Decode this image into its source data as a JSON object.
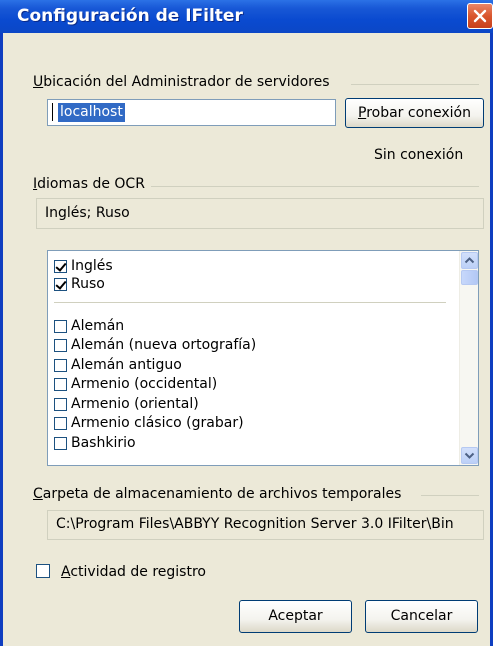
{
  "window": {
    "title": "Configuración de IFilter"
  },
  "server": {
    "label_key": "U",
    "label_rest": "bicación del Administrador de servidores",
    "value": "localhost",
    "test_key": "P",
    "test_rest": "robar conexión",
    "status": "Sin conexión"
  },
  "ocr": {
    "label_key": "I",
    "label_rest": "diomas de OCR",
    "selected_summary": "Inglés; Ruso",
    "checked": [
      {
        "label": "Inglés",
        "checked": true
      },
      {
        "label": "Ruso",
        "checked": true
      }
    ],
    "languages": [
      {
        "label": "Alemán",
        "checked": false
      },
      {
        "label": "Alemán (nueva ortografía)",
        "checked": false
      },
      {
        "label": "Alemán antiguo",
        "checked": false
      },
      {
        "label": "Armenio (occidental)",
        "checked": false
      },
      {
        "label": "Armenio (oriental)",
        "checked": false
      },
      {
        "label": "Armenio clásico (grabar)",
        "checked": false
      },
      {
        "label": "Bashkirio",
        "checked": false
      }
    ]
  },
  "temp": {
    "label_key": "C",
    "label_rest": "arpeta de almacenamiento de archivos temporales",
    "path": "C:\\Program Files\\ABBYY Recognition Server 3.0 IFilter\\Bin"
  },
  "log": {
    "label_key": "A",
    "label_rest": "ctividad de registro",
    "checked": false
  },
  "buttons": {
    "ok": "Aceptar",
    "cancel": "Cancelar"
  },
  "icons": {
    "close": "close-x-icon",
    "scroll_up": "scroll-up-arrow-icon",
    "scroll_down": "scroll-down-arrow-icon"
  },
  "colors": {
    "titlebar": "#0a4ad0",
    "close": "#d9562e",
    "dialog": "#ece9d8"
  }
}
